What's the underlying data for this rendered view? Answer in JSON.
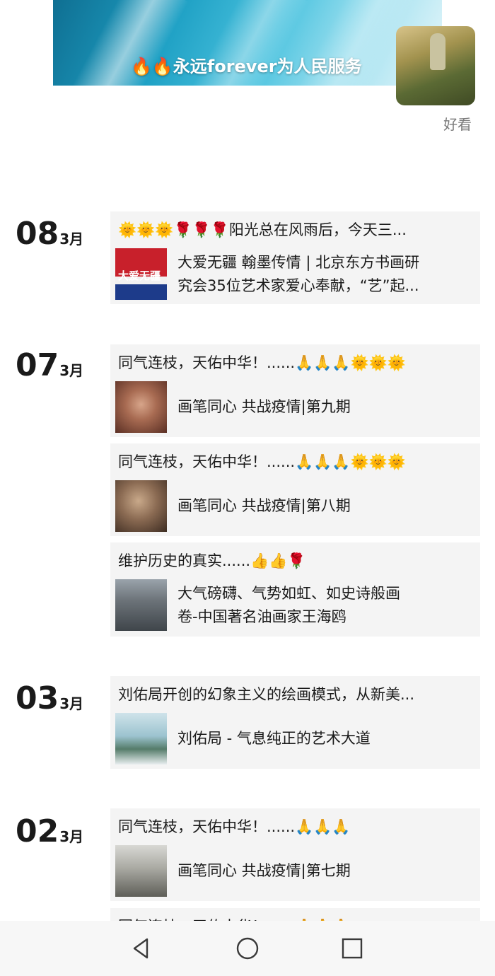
{
  "header": {
    "cover_caption": "🔥🔥永远forever为人民服务",
    "haokan_label": "好看"
  },
  "posts": [
    {
      "day": "08",
      "month": "3月",
      "entries": [
        {
          "title": "🌞🌞🌞🌹🌹🌹阳光总在风雨后，今天三...",
          "shared_line1": "大爱无疆 翰墨传情 | 北京东方书画研",
          "shared_line2": "究会35位艺术家爱心奉献，“艺”起...",
          "thumb_text": "大爱无疆"
        }
      ]
    },
    {
      "day": "07",
      "month": "3月",
      "entries": [
        {
          "title": "同气连枝，天佑中华！......🙏🙏🙏🌞🌞🌞",
          "shared_line1": "画笔同心 共战疫情|第九期"
        },
        {
          "title": "同气连枝，天佑中华！......🙏🙏🙏🌞🌞🌞",
          "shared_line1": "画笔同心 共战疫情|第八期"
        },
        {
          "title": "维护历史的真实......👍👍🌹",
          "shared_line1": "大气磅礴、气势如虹、如史诗般画",
          "shared_line2": "卷-中国著名油画家王海鸥"
        }
      ]
    },
    {
      "day": "03",
      "month": "3月",
      "entries": [
        {
          "title": "刘佑局开创的幻象主义的绘画模式，从新美...",
          "shared_line1": "刘佑局 - 气息纯正的艺术大道"
        }
      ]
    },
    {
      "day": "02",
      "month": "3月",
      "entries": [
        {
          "title": "同气连枝，天佑中华！......🙏🙏🙏",
          "shared_line1": "画笔同心 共战疫情|第七期"
        },
        {
          "title": "同气连枝，天佑中华！......🙏🙏🙏"
        }
      ]
    }
  ],
  "navbar": {
    "back": "back-icon",
    "home": "home-icon",
    "recents": "recents-icon"
  }
}
